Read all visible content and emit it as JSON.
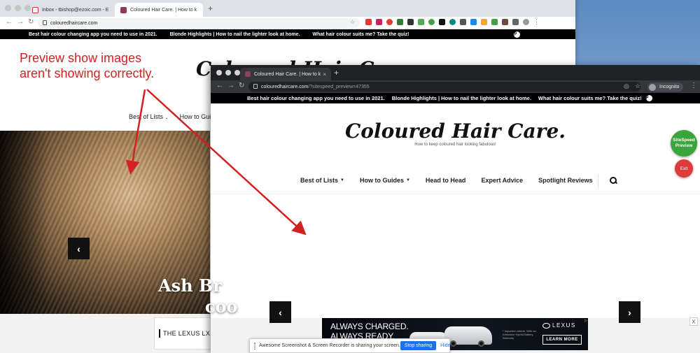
{
  "back_window": {
    "tabs": [
      {
        "label": "Inbox - tbishop@ezoic.com - E",
        "favicon_color": "#d93025"
      },
      {
        "label": "Coloured Hair Care. | How to k",
        "favicon_color": "#8b3d5a"
      }
    ],
    "url": "colouredhaircare.com",
    "topbar_links": [
      "Best hair colour changing app you need to use in 2021.",
      "Blonde Highlights | How to nail the lighter look at home.",
      "What hair colour suits me? Take the quiz!"
    ],
    "site_title_fragment": "Coloured Hair Care.",
    "nav": [
      "Best of Lists",
      "How to Gui"
    ],
    "slide_title": "Ash Br\n        coo",
    "ad_text": "THE LEXUS LX"
  },
  "front_window": {
    "tab_label": "Coloured Hair Care. | How to k",
    "url_host": "colouredhaircare.com",
    "url_path": "/?sitespeed_preview=47355",
    "incognito_label": "Incognito",
    "topbar_links": [
      "Best hair colour changing app you need to use in 2021.",
      "Blonde Highlights | How to nail the lighter look at home.",
      "What hair colour suits me? Take the quiz!"
    ],
    "site_title": "Coloured Hair Care.",
    "tagline": "How to keep coloured hair looking fabulous!",
    "nav": [
      {
        "label": "Best of Lists",
        "dropdown": true
      },
      {
        "label": "How to Guides",
        "dropdown": true
      },
      {
        "label": "Head to Head",
        "dropdown": false
      },
      {
        "label": "Expert Advice",
        "dropdown": false
      },
      {
        "label": "Spotlight Reviews",
        "dropdown": false
      }
    ]
  },
  "ad": {
    "headline": "ALWAYS CHARGED.\nALWAYS READY.",
    "fine_print": "* Imported vehicle. With an Extensive Hybrid Battery Warranty",
    "brand": "LEXUS",
    "cta": "LEARN MORE",
    "close": "X"
  },
  "sitespeed": {
    "preview_label": "SiteSpeed Preview",
    "exit_label": "Exit"
  },
  "annotation": {
    "text": "Preview show images\naren't showing correctly.",
    "color": "#d32020"
  },
  "share_bar": {
    "message": "Awesome Screenshot & Screen Recorder is sharing your screen.",
    "stop_label": "Stop sharing",
    "hide_label": "Hide"
  },
  "icons": {
    "prev": "‹",
    "next": "›",
    "pin": "p"
  }
}
